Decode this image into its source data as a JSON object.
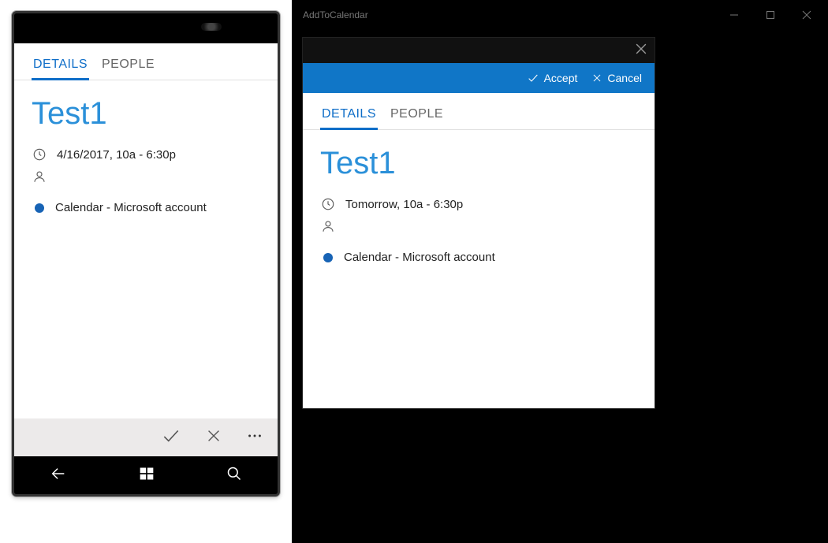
{
  "tabs": {
    "details": "DETAILS",
    "people": "PEOPLE"
  },
  "phone": {
    "event_title": "Test1",
    "when": "4/16/2017, 10a - 6:30p",
    "calendar": "Calendar - Microsoft account"
  },
  "desktop": {
    "window_title": "AddToCalendar",
    "accept": "Accept",
    "cancel": "Cancel",
    "event_title": "Test1",
    "when": "Tomorrow, 10a - 6:30p",
    "calendar": "Calendar - Microsoft account"
  },
  "colors": {
    "accent": "#0f6ec8",
    "command_bar": "#1076c7",
    "dot": "#1763b5"
  }
}
